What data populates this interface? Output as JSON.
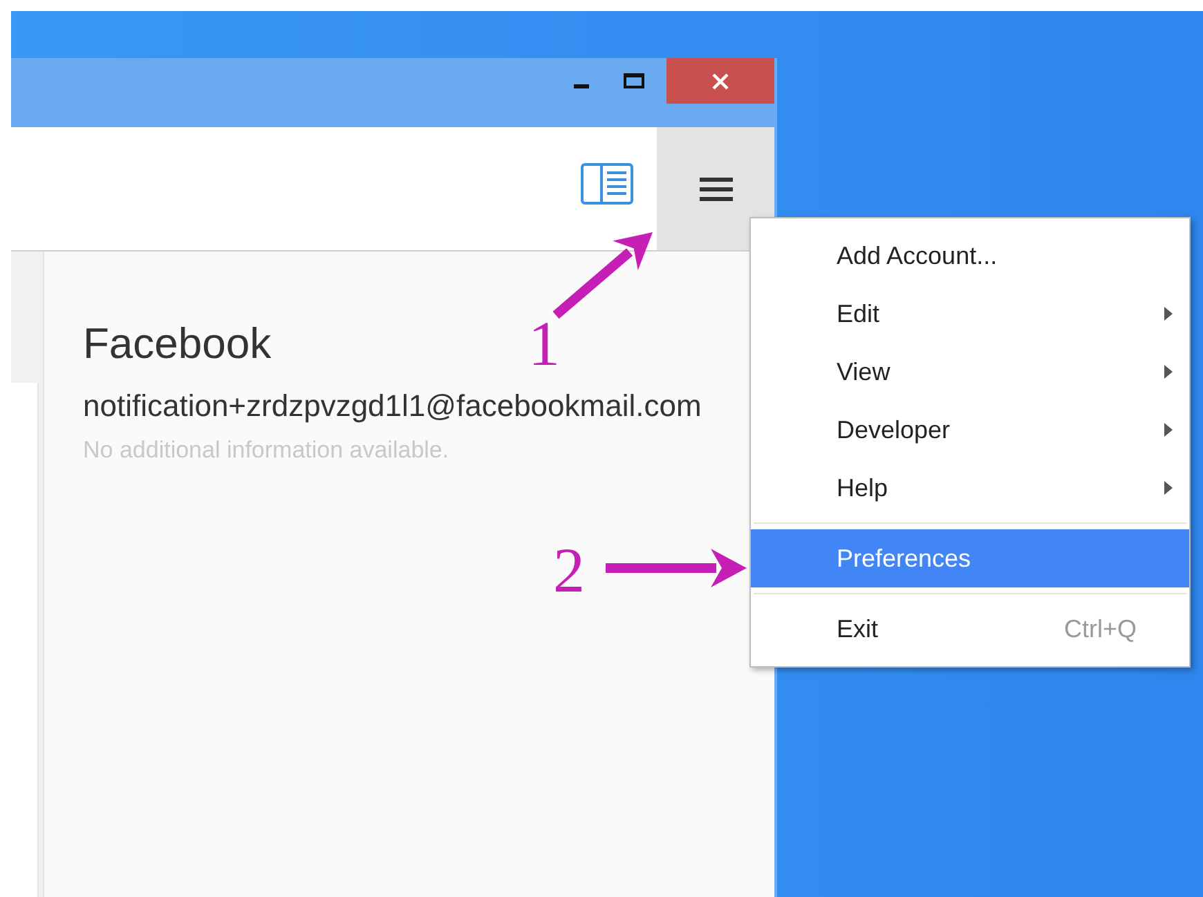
{
  "contact": {
    "name": "Facebook",
    "email": "notification+zrdzpvzgd1l1@facebookmail.com",
    "note": "No additional information available."
  },
  "menu": {
    "items": [
      {
        "kind": "item",
        "label": "Add Account...",
        "submenu": false,
        "selected": false
      },
      {
        "kind": "item",
        "label": "Edit",
        "submenu": true,
        "selected": false
      },
      {
        "kind": "item",
        "label": "View",
        "submenu": true,
        "selected": false
      },
      {
        "kind": "item",
        "label": "Developer",
        "submenu": true,
        "selected": false
      },
      {
        "kind": "item",
        "label": "Help",
        "submenu": true,
        "selected": false
      },
      {
        "kind": "separator"
      },
      {
        "kind": "item",
        "label": "Preferences",
        "submenu": false,
        "selected": true
      },
      {
        "kind": "separator"
      },
      {
        "kind": "item",
        "label": "Exit",
        "shortcut": "Ctrl+Q",
        "submenu": false,
        "selected": false
      }
    ]
  },
  "annotations": [
    {
      "label": "1"
    },
    {
      "label": "2"
    }
  ]
}
